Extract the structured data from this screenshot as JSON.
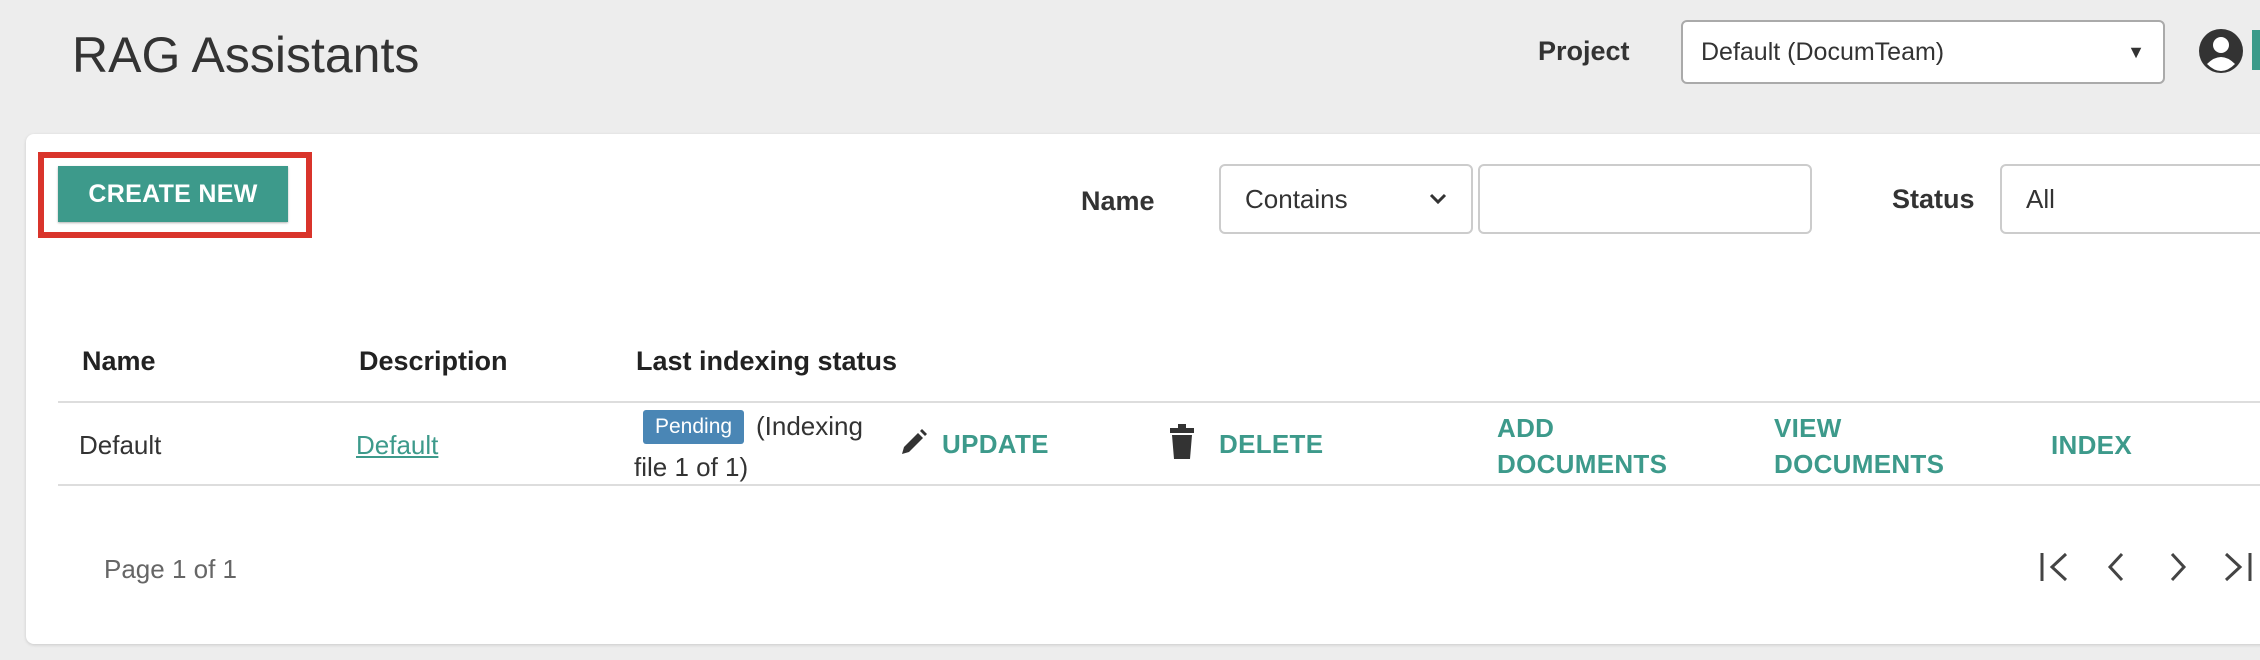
{
  "header": {
    "title": "RAG Assistants",
    "project_label": "Project",
    "project_value": "Default (DocumTeam)"
  },
  "toolbar": {
    "create_label": "CREATE NEW"
  },
  "filters": {
    "name_label": "Name",
    "name_operator": "Contains",
    "name_value": "",
    "status_label": "Status",
    "status_value": "All"
  },
  "table": {
    "columns": [
      "Name",
      "Description",
      "Last indexing status"
    ],
    "rows": [
      {
        "name": "Default",
        "description": "Default",
        "status_badge": "Pending",
        "status_text_1": "(Indexing",
        "status_text_2": "file 1 of 1)",
        "actions": {
          "update": "UPDATE",
          "delete": "DELETE",
          "add_documents_1": "ADD",
          "add_documents_2": "DOCUMENTS",
          "view_documents_1": "VIEW",
          "view_documents_2": "DOCUMENTS",
          "index": "INDEX"
        }
      }
    ]
  },
  "pagination": {
    "page_info": "Page 1 of 1"
  },
  "colors": {
    "accent": "#3d9a8b",
    "badge": "#4a86b5",
    "highlight": "#d9342b"
  }
}
